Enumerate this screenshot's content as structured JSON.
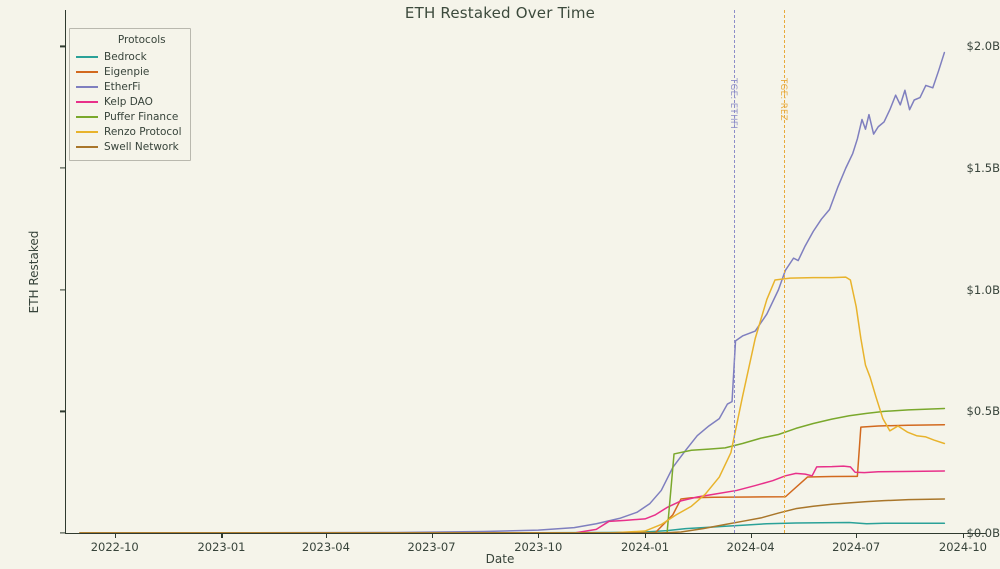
{
  "chart_data": {
    "type": "line",
    "title": "ETH Restaked Over Time",
    "xlabel": "Date",
    "ylabel": "ETH Restaked",
    "grid": false,
    "legend_position": "upper left",
    "legend_title": "Protocols",
    "xlim": [
      "2022-08-20",
      "2024-10-20"
    ],
    "ylim": [
      0,
      2.15
    ],
    "y_unit": "Billions USD",
    "yticks": [
      0,
      0.5,
      1.0,
      1.5,
      2.0
    ],
    "ytick_labels": [
      "$0.0B",
      "$0.5B",
      "$1.0B",
      "$1.5B",
      "$2.0B"
    ],
    "xticks": [
      "2022-10",
      "2023-01",
      "2023-04",
      "2023-07",
      "2023-10",
      "2024-01",
      "2024-04",
      "2024-07",
      "2024-10"
    ],
    "xtick_labels": [
      "2022-10",
      "2023-01",
      "2023-04",
      "2023-07",
      "2023-10",
      "2024-01",
      "2024-04",
      "2024-07",
      "2024-10"
    ],
    "annotations": [
      {
        "name": "TGE: ETHFI",
        "label": "TGE: ETHFI",
        "x": "2024-03-18",
        "color": "#8c8cc8",
        "style": "dashed-vline"
      },
      {
        "name": "TGE: REZ",
        "label": "TGE: REZ",
        "x": "2024-04-30",
        "color": "#e8a93a",
        "style": "dashed-vline"
      }
    ],
    "series": [
      {
        "name": "Bedrock",
        "color": "#2aa198",
        "points": [
          [
            "2022-09-01",
            0.0
          ],
          [
            "2023-06-01",
            0.0
          ],
          [
            "2023-10-01",
            0.001
          ],
          [
            "2023-12-01",
            0.002
          ],
          [
            "2024-01-01",
            0.004
          ],
          [
            "2024-01-20",
            0.01
          ],
          [
            "2024-02-05",
            0.018
          ],
          [
            "2024-02-20",
            0.022
          ],
          [
            "2024-03-10",
            0.028
          ],
          [
            "2024-03-25",
            0.032
          ],
          [
            "2024-04-15",
            0.038
          ],
          [
            "2024-05-10",
            0.041
          ],
          [
            "2024-06-01",
            0.042
          ],
          [
            "2024-06-25",
            0.043
          ],
          [
            "2024-07-10",
            0.038
          ],
          [
            "2024-07-25",
            0.04
          ],
          [
            "2024-08-20",
            0.04
          ],
          [
            "2024-09-15",
            0.04
          ]
        ]
      },
      {
        "name": "Eigenpie",
        "color": "#d2691e",
        "points": [
          [
            "2022-09-01",
            0.0
          ],
          [
            "2023-12-01",
            0.0
          ],
          [
            "2024-01-10",
            0.002
          ],
          [
            "2024-01-25",
            0.075
          ],
          [
            "2024-02-01",
            0.14
          ],
          [
            "2024-02-10",
            0.145
          ],
          [
            "2024-03-01",
            0.147
          ],
          [
            "2024-04-01",
            0.148
          ],
          [
            "2024-05-01",
            0.149
          ],
          [
            "2024-05-20",
            0.23
          ],
          [
            "2024-06-10",
            0.232
          ],
          [
            "2024-06-28",
            0.233
          ],
          [
            "2024-07-02",
            0.233
          ],
          [
            "2024-07-05",
            0.435
          ],
          [
            "2024-07-20",
            0.44
          ],
          [
            "2024-08-15",
            0.443
          ],
          [
            "2024-09-15",
            0.445
          ]
        ]
      },
      {
        "name": "EtherFi",
        "color": "#7f7fbf",
        "points": [
          [
            "2022-09-01",
            0.0
          ],
          [
            "2023-06-01",
            0.002
          ],
          [
            "2023-08-15",
            0.006
          ],
          [
            "2023-10-01",
            0.012
          ],
          [
            "2023-11-01",
            0.022
          ],
          [
            "2023-11-20",
            0.038
          ],
          [
            "2023-12-10",
            0.06
          ],
          [
            "2023-12-25",
            0.085
          ],
          [
            "2024-01-05",
            0.12
          ],
          [
            "2024-01-15",
            0.175
          ],
          [
            "2024-01-25",
            0.27
          ],
          [
            "2024-02-05",
            0.34
          ],
          [
            "2024-02-15",
            0.4
          ],
          [
            "2024-02-25",
            0.44
          ],
          [
            "2024-03-05",
            0.47
          ],
          [
            "2024-03-12",
            0.53
          ],
          [
            "2024-03-16",
            0.54
          ],
          [
            "2024-03-19",
            0.79
          ],
          [
            "2024-03-25",
            0.81
          ],
          [
            "2024-04-05",
            0.83
          ],
          [
            "2024-04-15",
            0.9
          ],
          [
            "2024-04-25",
            1.0
          ],
          [
            "2024-05-01",
            1.08
          ],
          [
            "2024-05-08",
            1.13
          ],
          [
            "2024-05-12",
            1.12
          ],
          [
            "2024-05-18",
            1.18
          ],
          [
            "2024-05-25",
            1.24
          ],
          [
            "2024-06-01",
            1.29
          ],
          [
            "2024-06-08",
            1.33
          ],
          [
            "2024-06-15",
            1.42
          ],
          [
            "2024-06-22",
            1.5
          ],
          [
            "2024-06-28",
            1.56
          ],
          [
            "2024-07-02",
            1.62
          ],
          [
            "2024-07-06",
            1.7
          ],
          [
            "2024-07-09",
            1.66
          ],
          [
            "2024-07-12",
            1.72
          ],
          [
            "2024-07-16",
            1.64
          ],
          [
            "2024-07-20",
            1.67
          ],
          [
            "2024-07-25",
            1.69
          ],
          [
            "2024-07-30",
            1.74
          ],
          [
            "2024-08-04",
            1.8
          ],
          [
            "2024-08-08",
            1.76
          ],
          [
            "2024-08-12",
            1.82
          ],
          [
            "2024-08-16",
            1.74
          ],
          [
            "2024-08-20",
            1.78
          ],
          [
            "2024-08-25",
            1.79
          ],
          [
            "2024-08-30",
            1.84
          ],
          [
            "2024-09-05",
            1.83
          ],
          [
            "2024-09-10",
            1.9
          ],
          [
            "2024-09-15",
            1.975
          ]
        ]
      },
      {
        "name": "Kelp DAO",
        "color": "#e8308a",
        "points": [
          [
            "2022-09-01",
            0.0
          ],
          [
            "2023-11-01",
            0.0
          ],
          [
            "2023-11-20",
            0.015
          ],
          [
            "2023-12-01",
            0.048
          ],
          [
            "2023-12-15",
            0.052
          ],
          [
            "2024-01-01",
            0.058
          ],
          [
            "2024-01-10",
            0.075
          ],
          [
            "2024-01-20",
            0.105
          ],
          [
            "2024-02-01",
            0.132
          ],
          [
            "2024-02-15",
            0.148
          ],
          [
            "2024-03-01",
            0.16
          ],
          [
            "2024-03-20",
            0.175
          ],
          [
            "2024-04-05",
            0.195
          ],
          [
            "2024-04-20",
            0.215
          ],
          [
            "2024-05-01",
            0.235
          ],
          [
            "2024-05-10",
            0.245
          ],
          [
            "2024-05-18",
            0.242
          ],
          [
            "2024-05-24",
            0.235
          ],
          [
            "2024-05-28",
            0.272
          ],
          [
            "2024-06-10",
            0.273
          ],
          [
            "2024-06-20",
            0.275
          ],
          [
            "2024-06-26",
            0.272
          ],
          [
            "2024-06-30",
            0.25
          ],
          [
            "2024-07-08",
            0.248
          ],
          [
            "2024-07-20",
            0.252
          ],
          [
            "2024-08-10",
            0.253
          ],
          [
            "2024-09-15",
            0.255
          ]
        ]
      },
      {
        "name": "Puffer Finance",
        "color": "#7aa82c",
        "points": [
          [
            "2022-09-01",
            0.0
          ],
          [
            "2024-01-20",
            0.0
          ],
          [
            "2024-01-26",
            0.325
          ],
          [
            "2024-02-10",
            0.34
          ],
          [
            "2024-02-25",
            0.345
          ],
          [
            "2024-03-10",
            0.35
          ],
          [
            "2024-03-25",
            0.368
          ],
          [
            "2024-04-10",
            0.39
          ],
          [
            "2024-04-25",
            0.405
          ],
          [
            "2024-05-10",
            0.43
          ],
          [
            "2024-05-25",
            0.45
          ],
          [
            "2024-06-10",
            0.468
          ],
          [
            "2024-06-25",
            0.482
          ],
          [
            "2024-07-10",
            0.492
          ],
          [
            "2024-07-25",
            0.5
          ],
          [
            "2024-08-15",
            0.506
          ],
          [
            "2024-09-15",
            0.512
          ]
        ]
      },
      {
        "name": "Renzo Protocol",
        "color": "#e8b32c",
        "points": [
          [
            "2022-09-01",
            0.0
          ],
          [
            "2023-12-01",
            0.0
          ],
          [
            "2024-01-01",
            0.008
          ],
          [
            "2024-01-15",
            0.035
          ],
          [
            "2024-01-28",
            0.075
          ],
          [
            "2024-02-10",
            0.11
          ],
          [
            "2024-02-22",
            0.16
          ],
          [
            "2024-03-05",
            0.23
          ],
          [
            "2024-03-15",
            0.33
          ],
          [
            "2024-03-25",
            0.56
          ],
          [
            "2024-04-05",
            0.8
          ],
          [
            "2024-04-15",
            0.96
          ],
          [
            "2024-04-22",
            1.04
          ],
          [
            "2024-05-05",
            1.048
          ],
          [
            "2024-05-25",
            1.05
          ],
          [
            "2024-06-10",
            1.05
          ],
          [
            "2024-06-22",
            1.052
          ],
          [
            "2024-06-26",
            1.04
          ],
          [
            "2024-07-01",
            0.93
          ],
          [
            "2024-07-05",
            0.8
          ],
          [
            "2024-07-09",
            0.69
          ],
          [
            "2024-07-13",
            0.64
          ],
          [
            "2024-07-18",
            0.56
          ],
          [
            "2024-07-24",
            0.47
          ],
          [
            "2024-07-30",
            0.42
          ],
          [
            "2024-08-06",
            0.44
          ],
          [
            "2024-08-14",
            0.415
          ],
          [
            "2024-08-22",
            0.4
          ],
          [
            "2024-08-30",
            0.395
          ],
          [
            "2024-09-06",
            0.382
          ],
          [
            "2024-09-15",
            0.368
          ]
        ]
      },
      {
        "name": "Swell Network",
        "color": "#a9762a",
        "points": [
          [
            "2022-09-01",
            0.0
          ],
          [
            "2024-01-15",
            0.0
          ],
          [
            "2024-02-01",
            0.004
          ],
          [
            "2024-02-20",
            0.018
          ],
          [
            "2024-03-10",
            0.035
          ],
          [
            "2024-03-25",
            0.048
          ],
          [
            "2024-04-10",
            0.062
          ],
          [
            "2024-04-25",
            0.082
          ],
          [
            "2024-05-10",
            0.1
          ],
          [
            "2024-05-25",
            0.11
          ],
          [
            "2024-06-10",
            0.118
          ],
          [
            "2024-06-25",
            0.124
          ],
          [
            "2024-07-10",
            0.129
          ],
          [
            "2024-07-25",
            0.133
          ],
          [
            "2024-08-15",
            0.137
          ],
          [
            "2024-09-15",
            0.14
          ]
        ]
      }
    ]
  }
}
